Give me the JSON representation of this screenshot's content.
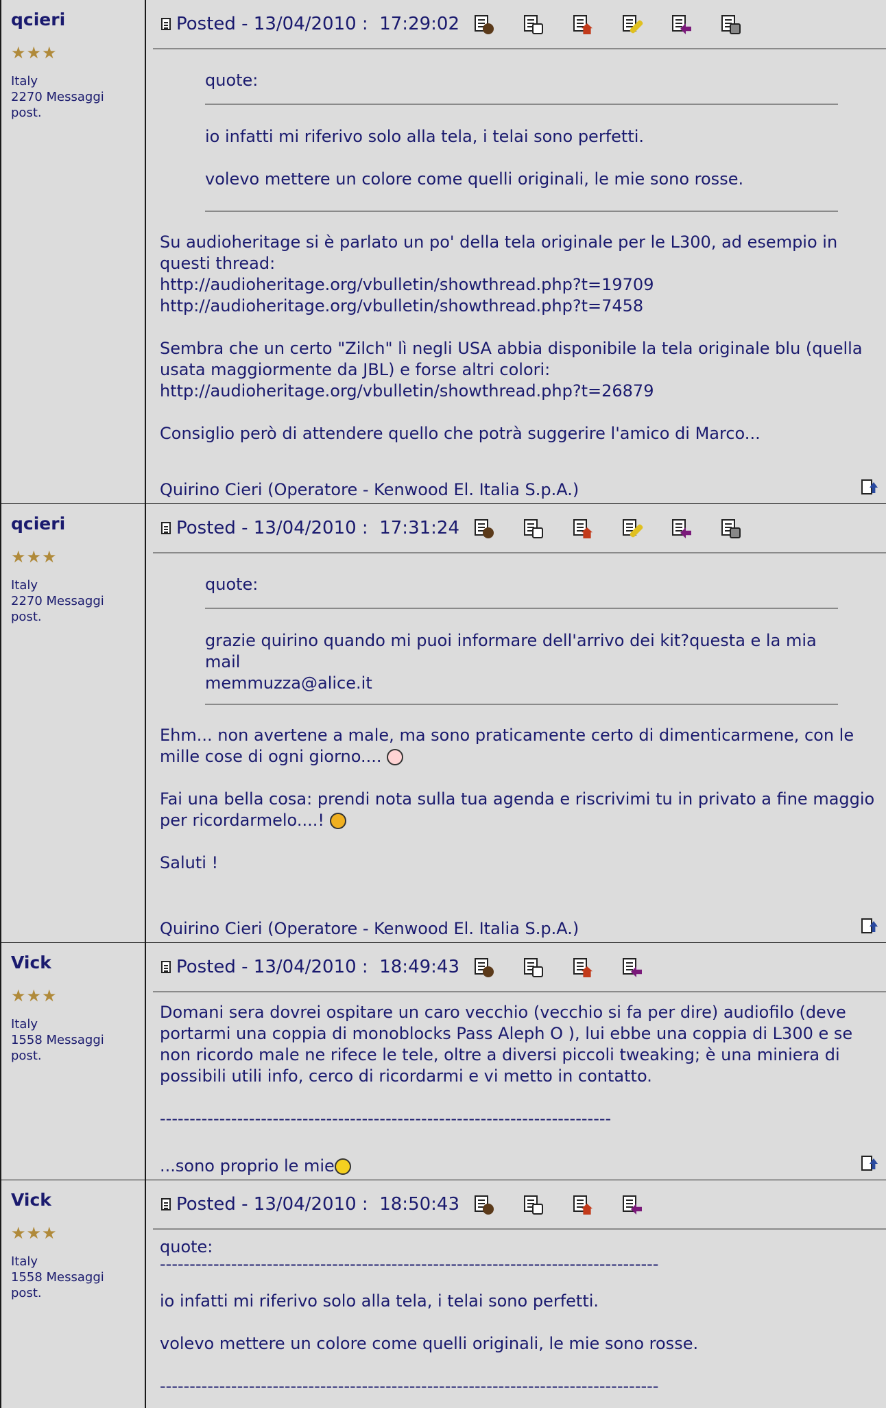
{
  "posts": [
    {
      "author": "qcieri",
      "stars": "★★★",
      "country": "Italy",
      "messages": "2270 Messaggi",
      "post_label": "post.",
      "posted": "Posted - 13/04/2010 :  17:29:02",
      "quote_label": "quote:",
      "quote_lines": [
        "io infatti mi riferivo solo alla tela, i telai sono perfetti.",
        "volevo mettere un colore come quelli originali, le mie sono rosse."
      ],
      "para1_text": "Su audioheritage si è parlato un po' della tela originale per le L300, ad esempio in questi thread:",
      "link1": "http://audioheritage.org/vbulletin/showthread.php?t=19709",
      "link2": "http://audioheritage.org/vbulletin/showthread.php?t=7458",
      "para2_text": "Sembra che un certo \"Zilch\" lì negli USA abbia disponibile la tela originale blu (quella usata maggiormente da JBL) e forse altri colori:",
      "link3": "http://audioheritage.org/vbulletin/showthread.php?t=26879",
      "para3_text": "Consiglio però di attendere quello che potrà suggerire l'amico di Marco...",
      "signature": "Quirino Cieri (Operatore - Kenwood El. Italia S.p.A.)"
    },
    {
      "author": "qcieri",
      "stars": "★★★",
      "country": "Italy",
      "messages": "2270 Messaggi",
      "post_label": "post.",
      "posted": "Posted - 13/04/2010 :  17:31:24",
      "quote_label": "quote:",
      "quote_line1": "grazie quirino quando mi puoi informare dell'arrivo dei kit?questa e la mia mail",
      "quote_email": "memmuzza@alice.it",
      "para1_text": "Ehm... non avertene a male, ma sono praticamente certo di dimenticarmene, con le mille cose di ogni giorno....",
      "para2_text": "Fai una bella cosa: prendi nota sulla tua agenda e riscrivimi tu in privato a fine maggio per ricordarmelo....!",
      "para3_text": "Saluti !",
      "signature": "Quirino Cieri (Operatore - Kenwood El. Italia S.p.A.)"
    },
    {
      "author": "Vick",
      "stars": "★★★",
      "country": "Italy",
      "messages": "1558 Messaggi",
      "post_label": "post.",
      "posted": "Posted - 13/04/2010 :  18:49:43",
      "para1_text": "Domani sera dovrei ospitare un caro vecchio (vecchio si fa per dire) audiofilo (deve portarmi una coppia di monoblocks Pass Aleph O ), lui ebbe una coppia di L300 e se non ricordo male ne rifece le tele, oltre a diversi piccoli tweaking; è una miniera di possibili utili info, cerco di ricordarmi e vi metto in contatto.",
      "dashes": "----------------------------------------------------------------------------",
      "signature": "...sono proprio le mie"
    },
    {
      "author": "Vick",
      "stars": "★★★",
      "country": "Italy",
      "messages": "1558 Messaggi",
      "post_label": "post.",
      "posted": "Posted - 13/04/2010 :  18:50:43",
      "quote_label": "quote:",
      "dashes": "------------------------------------------------------------------------------------",
      "quote_lines": [
        "io infatti mi riferivo solo alla tela, i telai sono perfetti.",
        "volevo mettere un colore come quelli originali, le mie sono rosse."
      ]
    }
  ],
  "icons": {
    "post_icon": "doc-icon",
    "profile": "profile-icon",
    "email": "email-icon",
    "homepage": "homepage-icon",
    "edit": "edit-icon",
    "reply_quote": "reply-quote-icon",
    "delete": "delete-icon",
    "top": "go-to-top-icon"
  },
  "colors": {
    "text": "#1a1a6e",
    "background": "#dcdcdc",
    "stars": "#b08a3a"
  }
}
